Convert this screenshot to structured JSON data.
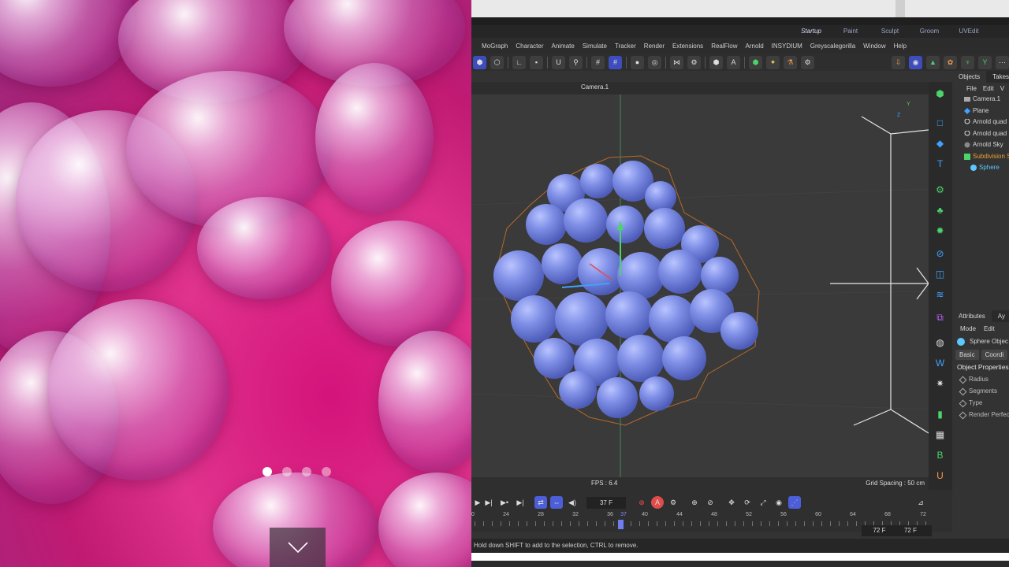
{
  "website": {
    "carousel_dots": 4,
    "active_dot": 0,
    "scroll_icon": "chevron-down-icon"
  },
  "c4d": {
    "layouts": [
      "Startup",
      "Paint",
      "Sculpt",
      "Groom",
      "UVEdit"
    ],
    "active_layout": "Startup",
    "menu": [
      "MoGraph",
      "Character",
      "Animate",
      "Simulate",
      "Tracker",
      "Render",
      "Extensions",
      "RealFlow",
      "Arnold",
      "INSYDIUM",
      "Greyscalegorilla",
      "Window",
      "Help"
    ],
    "viewport": {
      "camera": "Camera.1",
      "fps": "FPS : 6.4",
      "grid_spacing": "Grid Spacing : 50 cm"
    },
    "objects_panel": {
      "tabs": [
        "Objects",
        "Takes"
      ],
      "menu": [
        "File",
        "Edit",
        "V"
      ],
      "items": [
        {
          "name": "Camera.1"
        },
        {
          "name": "Plane"
        },
        {
          "name": "Arnold quad"
        },
        {
          "name": "Arnold quad"
        },
        {
          "name": "Arnold Sky"
        },
        {
          "name": "Subdivision S"
        },
        {
          "name": "Sphere"
        }
      ]
    },
    "attributes_panel": {
      "tabs": [
        "Attributes",
        "Ay"
      ],
      "menu": [
        "Mode",
        "Edit"
      ],
      "object": "Sphere Objec",
      "subtabs": [
        "Basic",
        "Coordi"
      ],
      "section": "Object Properties",
      "properties": [
        "Radius",
        "Segments",
        "Type",
        "Render Perfec"
      ]
    },
    "timeline": {
      "current_frame": "37 F",
      "ruler_labels": [
        "0",
        "24",
        "28",
        "32",
        "36",
        "37",
        "40",
        "44",
        "48",
        "52",
        "56",
        "60",
        "64",
        "68",
        "72"
      ],
      "end_frame": "72 F",
      "end_frame2": "72 F"
    },
    "status": "Hold down SHIFT to add to the selection, CTRL to remove."
  }
}
